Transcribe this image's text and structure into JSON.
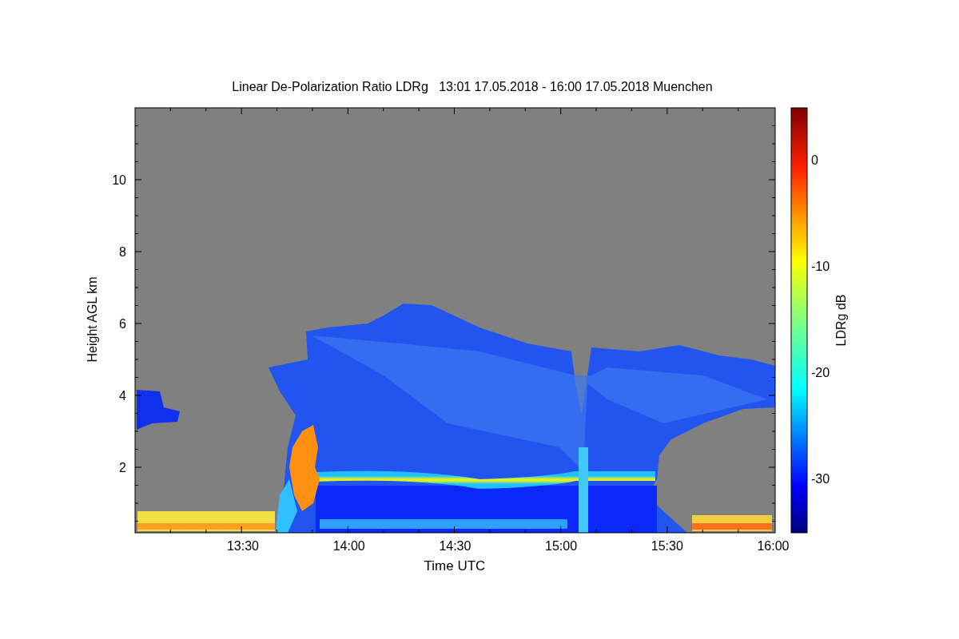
{
  "title": "Linear De-Polarization Ratio LDRg   13:01 17.05.2018 - 16:00 17.05.2018 Muenchen",
  "x_axis": {
    "label": "Time UTC",
    "tick_labels": [
      "13:30",
      "14:00",
      "14:30",
      "15:00",
      "15:30",
      "16:00"
    ]
  },
  "y_axis": {
    "label": "Height AGL km",
    "tick_labels": [
      "10",
      "8",
      "6",
      "4",
      "2"
    ]
  },
  "colorbar": {
    "label": "LDRg dB",
    "tick_labels": [
      "0",
      "-10",
      "-20",
      "-30"
    ]
  }
}
